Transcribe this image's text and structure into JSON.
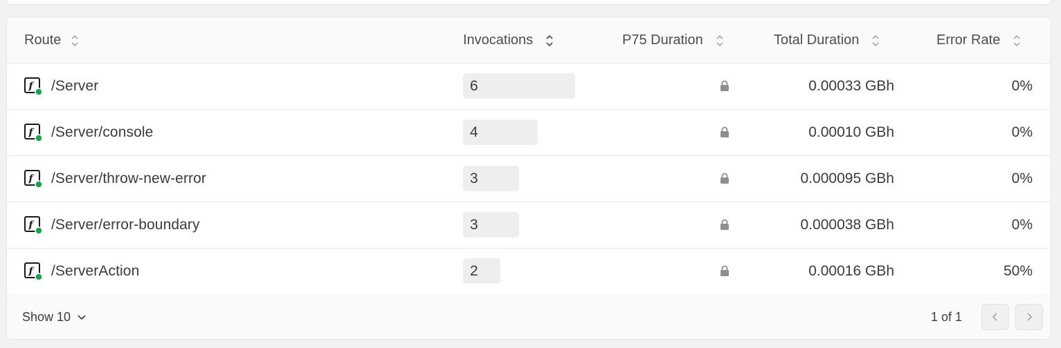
{
  "table": {
    "columns": [
      {
        "label": "Route"
      },
      {
        "label": "Invocations"
      },
      {
        "label": "P75 Duration"
      },
      {
        "label": "Total Duration"
      },
      {
        "label": "Error Rate"
      }
    ],
    "rows": [
      {
        "route": "/Server",
        "invocations": "6",
        "invocations_fraction": 1.0,
        "p75_icon": "lock-icon",
        "total_duration": "0.00033 GBh",
        "error_rate": "0%"
      },
      {
        "route": "/Server/console",
        "invocations": "4",
        "invocations_fraction": 0.667,
        "p75_icon": "lock-icon",
        "total_duration": "0.00010 GBh",
        "error_rate": "0%"
      },
      {
        "route": "/Server/throw-new-error",
        "invocations": "3",
        "invocations_fraction": 0.5,
        "p75_icon": "lock-icon",
        "total_duration": "0.000095 GBh",
        "error_rate": "0%"
      },
      {
        "route": "/Server/error-boundary",
        "invocations": "3",
        "invocations_fraction": 0.5,
        "p75_icon": "lock-icon",
        "total_duration": "0.000038 GBh",
        "error_rate": "0%"
      },
      {
        "route": "/ServerAction",
        "invocations": "2",
        "invocations_fraction": 0.333,
        "p75_icon": "lock-icon",
        "total_duration": "0.00016 GBh",
        "error_rate": "50%"
      }
    ]
  },
  "footer": {
    "page_size_label": "Show 10",
    "page_info": "1 of 1"
  },
  "icons": {
    "route": "function-icon",
    "status_dot": "status-dot-icon",
    "sort": "sort-icon",
    "chevron_down": "chevron-down-icon",
    "prev": "chevron-left-icon",
    "next": "chevron-right-icon"
  },
  "colors": {
    "status_green": "#17a34a",
    "bar_fill": "#eeeeee",
    "lock": "#8f8f8f"
  }
}
